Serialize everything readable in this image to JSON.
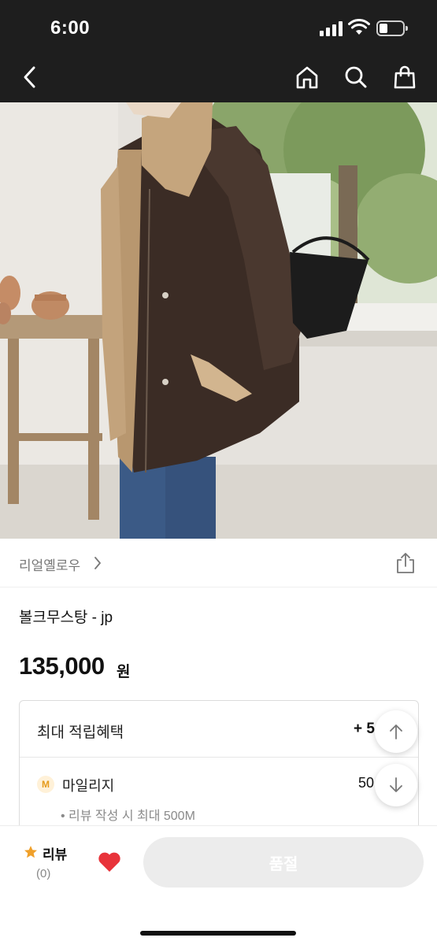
{
  "status_bar": {
    "time": "6:00",
    "icons": [
      "cellular-signal-icon",
      "wifi-icon",
      "battery-icon"
    ]
  },
  "header": {
    "back_icon": "chevron-left-icon",
    "actions": [
      "home-icon",
      "search-icon",
      "shopping-bag-icon"
    ],
    "background": "#1e1e1e"
  },
  "hero": {
    "image_icon": "product-photo"
  },
  "brand": {
    "name": "리얼옐로우",
    "chevron_icon": "chevron-right-icon",
    "share_icon": "share-icon"
  },
  "product": {
    "name": "볼크무스탕 - jp",
    "price": "135,000",
    "currency": "원"
  },
  "benefits": {
    "title": "최대 적립혜택",
    "total": "+ 5",
    "mileage_badge": "M",
    "mileage_label": "마일리지",
    "mileage_value": "50",
    "mileage_note": "• 리뷰 작성 시 최대 500M",
    "badge_color": "#e59b1c"
  },
  "scroll_controls": {
    "up_icon": "arrow-up-icon",
    "down_icon": "arrow-down-icon"
  },
  "bottom_bar": {
    "review_label": "리뷰",
    "review_count": "(0)",
    "star_color": "#f0a02a",
    "heart_color": "#e8333a",
    "soldout_label": "품절"
  }
}
